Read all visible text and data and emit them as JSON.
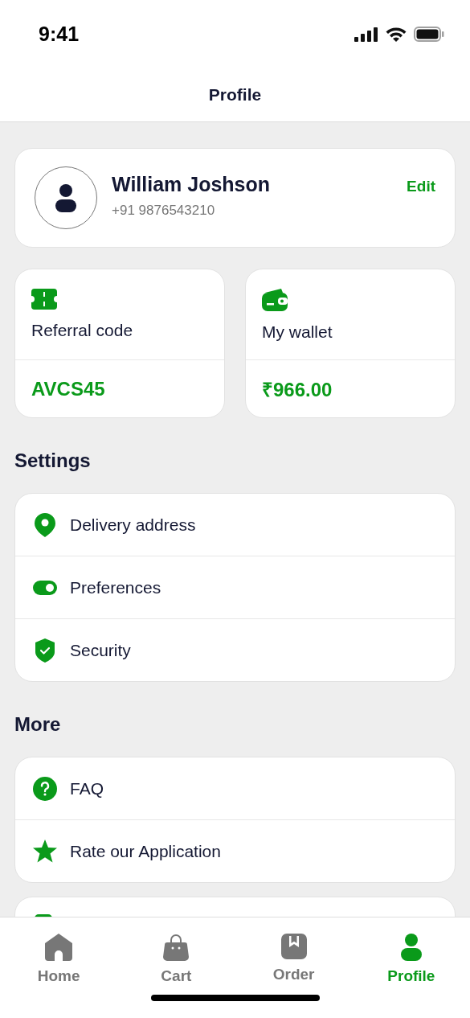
{
  "status_bar": {
    "time": "9:41"
  },
  "header": {
    "title": "Profile"
  },
  "profile": {
    "name": "William Joshson",
    "phone": "+91 9876543210",
    "edit_label": "Edit"
  },
  "cards": [
    {
      "kind": "referral",
      "label": "Referral code",
      "value": "AVCS45"
    },
    {
      "kind": "wallet",
      "label": "My wallet",
      "value": "₹966.00"
    }
  ],
  "sections": [
    {
      "title": "Settings",
      "items": [
        {
          "kind": "location",
          "label": "Delivery address"
        },
        {
          "kind": "toggle",
          "label": "Preferences"
        },
        {
          "kind": "shield",
          "label": "Security"
        }
      ]
    },
    {
      "title": "More",
      "items": [
        {
          "kind": "faq",
          "label": "FAQ"
        },
        {
          "kind": "star",
          "label": "Rate our Application"
        }
      ]
    }
  ],
  "tabs": [
    {
      "kind": "home",
      "label": "Home",
      "selected": false
    },
    {
      "kind": "cart",
      "label": "Cart",
      "selected": false
    },
    {
      "kind": "order",
      "label": "Order",
      "selected": false
    },
    {
      "kind": "profile",
      "label": "Profile",
      "selected": true
    }
  ]
}
